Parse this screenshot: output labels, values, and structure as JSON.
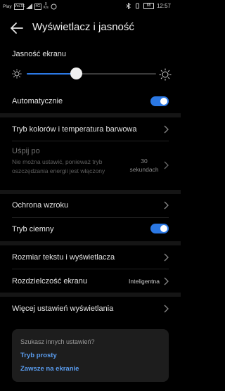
{
  "status_bar": {
    "carrier": "Play",
    "net1": "VoLTE",
    "net2": "4G",
    "data_rate_value": "0",
    "data_rate_unit": "K/s",
    "battery": "88",
    "time": "12:57"
  },
  "header": {
    "title": "Wyświetlacz i jasność"
  },
  "brightness": {
    "label": "Jasność ekranu",
    "level": 0.38
  },
  "auto": {
    "label": "Automatycznie",
    "on": true
  },
  "color_mode": {
    "label": "Tryb kolorów i temperatura barwowa"
  },
  "sleep": {
    "label": "Uśpij po",
    "description": "Nie można ustawić, ponieważ tryb oszczędzania energii jest włączony",
    "value_number": "30",
    "value_unit": "sekundach"
  },
  "eye_comfort": {
    "label": "Ochrona wzroku"
  },
  "dark_mode": {
    "label": "Tryb ciemny",
    "on": true
  },
  "text_size": {
    "label": "Rozmiar tekstu i wyświetlacza"
  },
  "resolution": {
    "label": "Rozdzielczość ekranu",
    "value": "Inteligentna"
  },
  "more_settings": {
    "label": "Więcej ustawień wyświetlania"
  },
  "suggestions": {
    "title": "Szukasz innych ustawień?",
    "link1": "Tryb prosty",
    "link2": "Zawsze na ekranie"
  },
  "colors": {
    "accent": "#2b78e4",
    "link": "#5a9df0",
    "background": "#000000"
  }
}
